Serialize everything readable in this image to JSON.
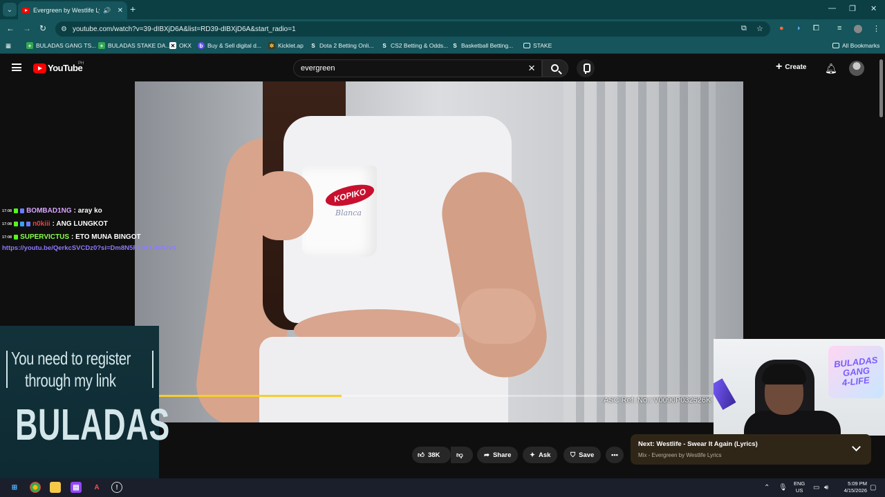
{
  "browser": {
    "tab_title": "Evergreen by Westlife Lyrics",
    "url": "youtube.com/watch?v=39-dIBXjD6A&list=RD39-dIBXjD6A&start_radio=1",
    "bookmarks": [
      "BULADAS GANG TS...",
      "BULADAS STAKE DA...",
      "OKX",
      "Buy & Sell digital d...",
      "Kicklet.ap",
      "Dota 2 Betting Onli...",
      "CS2 Betting & Odds...",
      "Basketball Betting...",
      "STAKE"
    ],
    "all_bookmarks": "All Bookmarks"
  },
  "youtube": {
    "logo_text": "YouTube",
    "country": "PH",
    "search_value": "evergreen",
    "create_label": "Create"
  },
  "video": {
    "mug_brand": "KOPIKO",
    "mug_script": "Blanca",
    "ad_ref": "ASC Ref. No.: V0090P032526K",
    "progress_fraction": 0.33
  },
  "chat": {
    "messages": [
      {
        "time": "17:08",
        "name": "BOMBAD1NG",
        "text": ": aray ko",
        "color": "#d7a4ff"
      },
      {
        "time": "17:08",
        "name": "n0kiii",
        "text": ": ANG LUNGKOT",
        "color": "#ff3b3b"
      },
      {
        "time": "17:08",
        "name": "SUPERVICTUS",
        "text": ": ETO MUNA BINGOT",
        "color": "#8cff4f"
      }
    ],
    "link": "https://youtu.be/QerkcSVCDz0?si=Dm8N5FeGLL40S7v1"
  },
  "promo": {
    "line1": "You need to register",
    "line2": "through my link",
    "brand": "BULADAS"
  },
  "webcam": {
    "sign_line1": "BULADAS",
    "sign_line2": "GANG",
    "sign_line3": "4-LIFE"
  },
  "actions": {
    "likes": "38K",
    "share": "Share",
    "ask": "Ask",
    "save": "Save"
  },
  "up_next": {
    "title": "Next: Westlife - Swear It Again (Lyrics)",
    "subtitle": "Mix - Evergreen by Westlife Lyrics"
  },
  "taskbar": {
    "lang": "ENG",
    "region": "US",
    "time": "5:09 PM",
    "date": "4/15/2026"
  },
  "colors": {
    "browser_frame": "#0b3f44",
    "progress": "#f5cf2a",
    "yt_red": "#ff0000"
  }
}
